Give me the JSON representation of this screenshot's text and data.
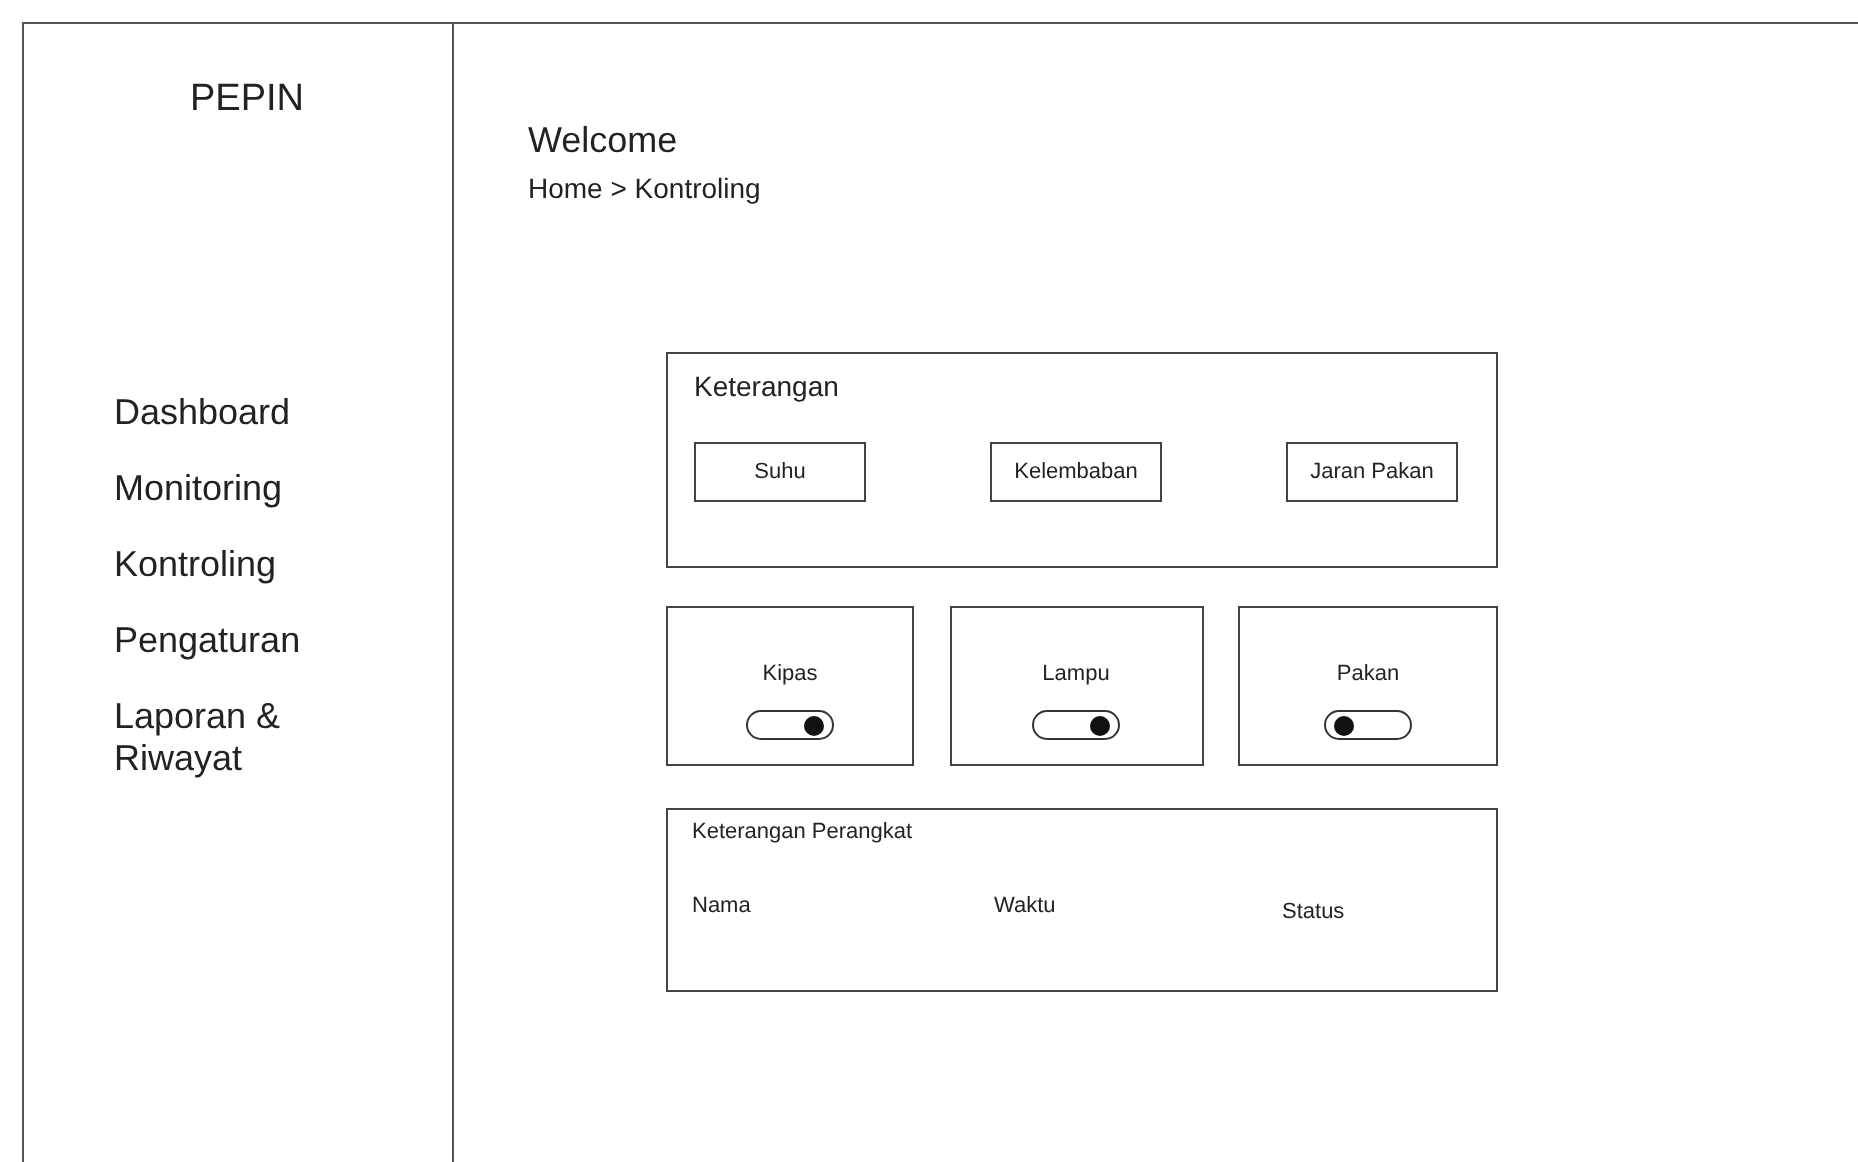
{
  "sidebar": {
    "title": "PEPIN",
    "items": [
      {
        "label": "Dashboard"
      },
      {
        "label": "Monitoring"
      },
      {
        "label": "Kontroling"
      },
      {
        "label": "Pengaturan"
      },
      {
        "label": "Laporan & Riwayat"
      }
    ]
  },
  "header": {
    "title": "Welcome",
    "breadcrumb": "Home > Kontroling"
  },
  "info_panel": {
    "title": "Keterangan",
    "buttons": [
      "Suhu",
      "Kelembaban",
      "Jaran Pakan"
    ]
  },
  "controls": [
    {
      "label": "Kipas",
      "on": true
    },
    {
      "label": "Lampu",
      "on": true
    },
    {
      "label": "Pakan",
      "on": false
    }
  ],
  "device_panel": {
    "title": "Keterangan Perangkat",
    "columns": [
      "Nama",
      "Waktu",
      "Status"
    ]
  }
}
